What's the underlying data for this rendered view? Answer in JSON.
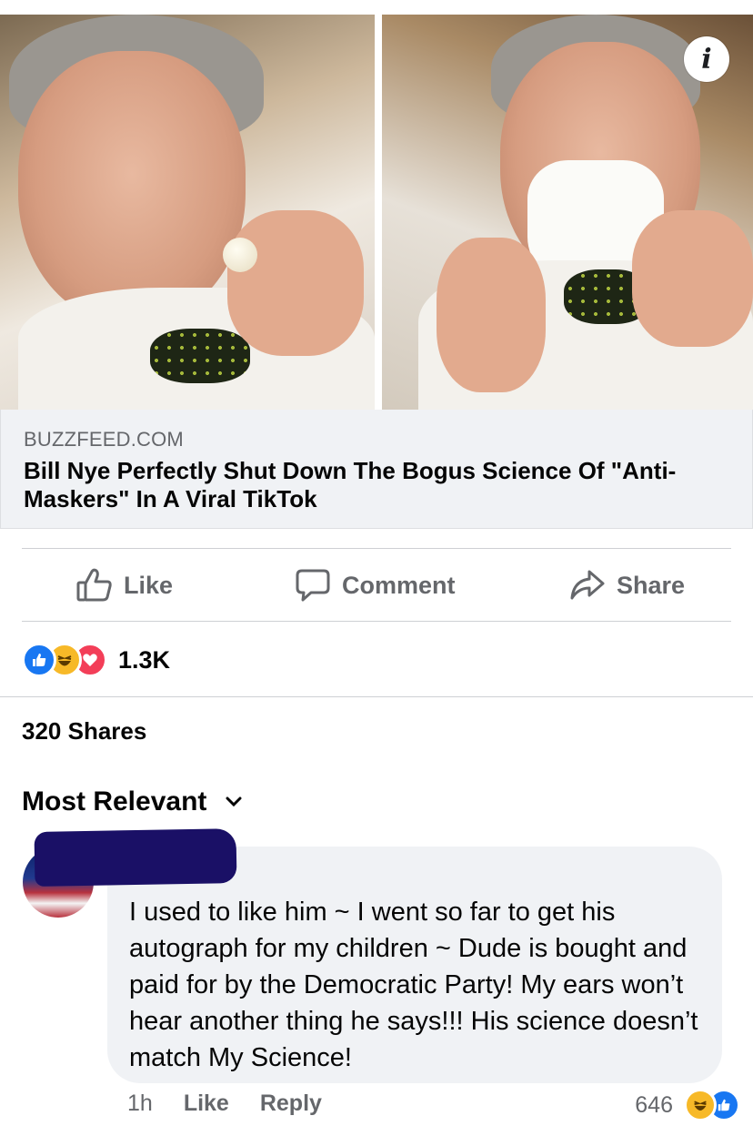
{
  "link_preview": {
    "domain": "BUZZFEED.COM",
    "title": "Bill Nye Perfectly Shut Down The Bogus Science Of \"Anti-Maskers\" In A Viral TikTok",
    "info_icon": "info-icon"
  },
  "actions": {
    "like": "Like",
    "comment": "Comment",
    "share": "Share"
  },
  "reactions": {
    "types": [
      "like",
      "haha",
      "love"
    ],
    "count": "1.3K"
  },
  "shares": "320 Shares",
  "sort": {
    "label": "Most Relevant"
  },
  "comment": {
    "text": "I used to like him ~ I went so far to get his autograph for my children ~ Dude is bought and paid for by the Democratic Party! My ears won’t hear another thing he says!!! His science doesn’t match My Science!",
    "time": "1h",
    "like_label": "Like",
    "reply_label": "Reply",
    "reaction_count": "646",
    "reaction_types": [
      "haha",
      "like"
    ]
  },
  "colors": {
    "accent": "#1877f2",
    "secondary_text": "#65676b",
    "bubble": "#f0f2f5",
    "haha": "#f7b928",
    "love": "#f33e58"
  }
}
